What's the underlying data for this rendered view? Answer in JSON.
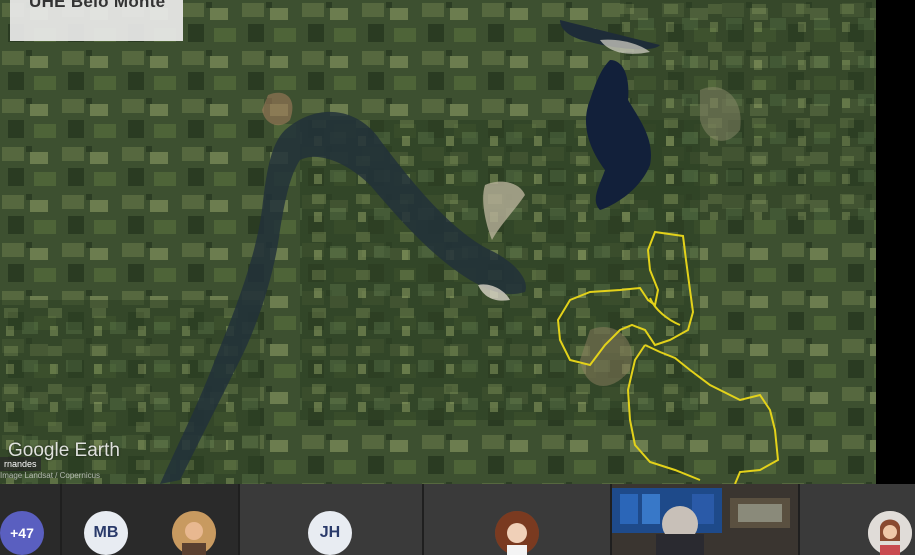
{
  "map": {
    "title": "UHE Belo Monte",
    "logo": "Google Earth",
    "credit": "Image Landsat / Copernicus",
    "presenter_name_fragment": "rnandes",
    "colors": {
      "boundary": "#e3d21a",
      "water": "#1a2a3a",
      "forest": "#2f4226",
      "cleared": "#6b7a4a"
    }
  },
  "participants": {
    "more_count": "+47",
    "items": [
      {
        "initials": "MB"
      },
      {
        "type": "photo"
      },
      {
        "initials": "JH"
      },
      {
        "type": "photo"
      },
      {
        "type": "video"
      },
      {
        "type": "photo"
      }
    ]
  }
}
